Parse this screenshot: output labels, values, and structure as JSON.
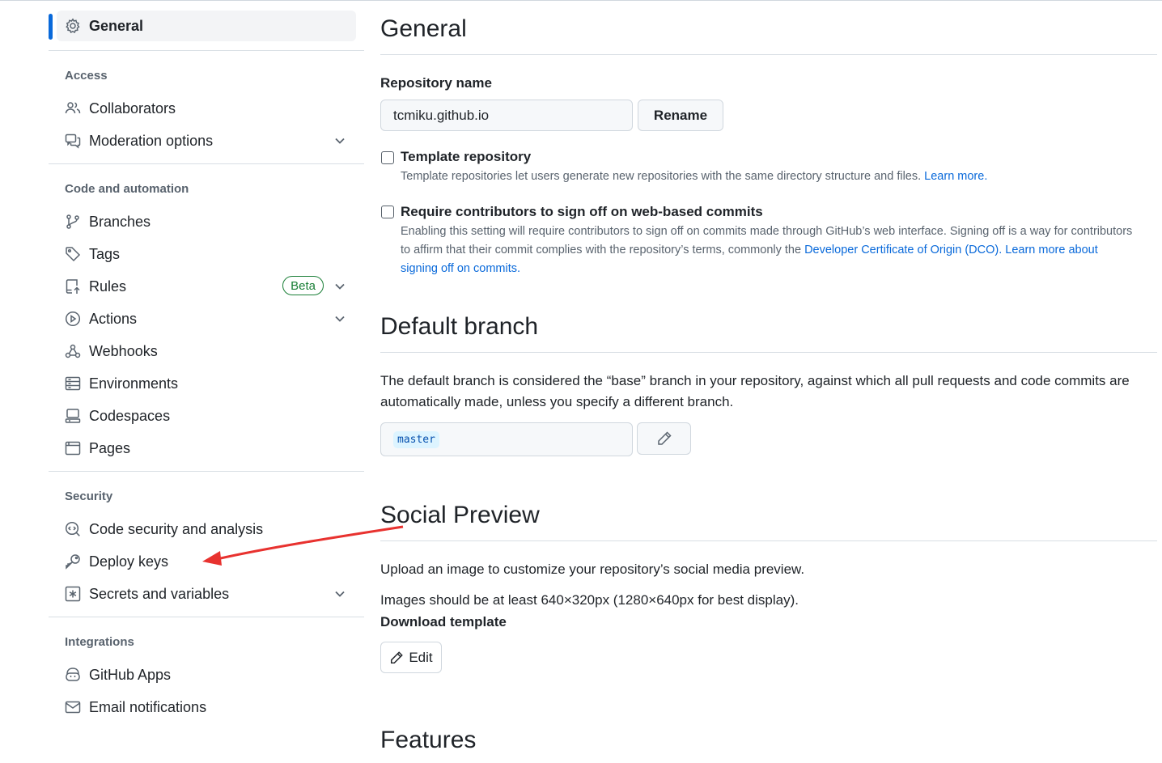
{
  "sidebar": {
    "general": "General",
    "groups": {
      "access": "Access",
      "code_automation": "Code and automation",
      "security": "Security",
      "integrations": "Integrations"
    },
    "items": {
      "collaborators": "Collaborators",
      "moderation": "Moderation options",
      "branches": "Branches",
      "tags": "Tags",
      "rules": "Rules",
      "rules_badge": "Beta",
      "actions": "Actions",
      "webhooks": "Webhooks",
      "environments": "Environments",
      "codespaces": "Codespaces",
      "pages": "Pages",
      "code_security": "Code security and analysis",
      "deploy_keys": "Deploy keys",
      "secrets": "Secrets and variables",
      "github_apps": "GitHub Apps",
      "email_notifications": "Email notifications"
    }
  },
  "main": {
    "general_title": "General",
    "repo_name_label": "Repository name",
    "repo_name_value": "tcmiku.github.io",
    "rename_button": "Rename",
    "template": {
      "title": "Template repository",
      "desc": "Template repositories let users generate new repositories with the same directory structure and files.",
      "link": "Learn more."
    },
    "signoff": {
      "title": "Require contributors to sign off on web-based commits",
      "desc": "Enabling this setting will require contributors to sign off on commits made through GitHub’s web interface. Signing off is a way for contributors to affirm that their commit complies with the repository’s terms, commonly the",
      "dco_link": "Developer Certificate of Origin (DCO).",
      "learn_link": "Learn more about signing off on commits."
    },
    "default_branch": {
      "title": "Default branch",
      "desc": "The default branch is considered the “base” branch in your repository, against which all pull requests and code commits are automatically made, unless you specify a different branch.",
      "branch": "master"
    },
    "social_preview": {
      "title": "Social Preview",
      "desc": "Upload an image to customize your repository’s social media preview.",
      "size_note": "Images should be at least 640×320px (1280×640px for best display).",
      "download_link": "Download template",
      "edit_button": "Edit"
    },
    "features_title": "Features"
  },
  "colors": {
    "accent": "#0969da",
    "arrow": "#e8322f",
    "beta": "#1a7f37"
  }
}
